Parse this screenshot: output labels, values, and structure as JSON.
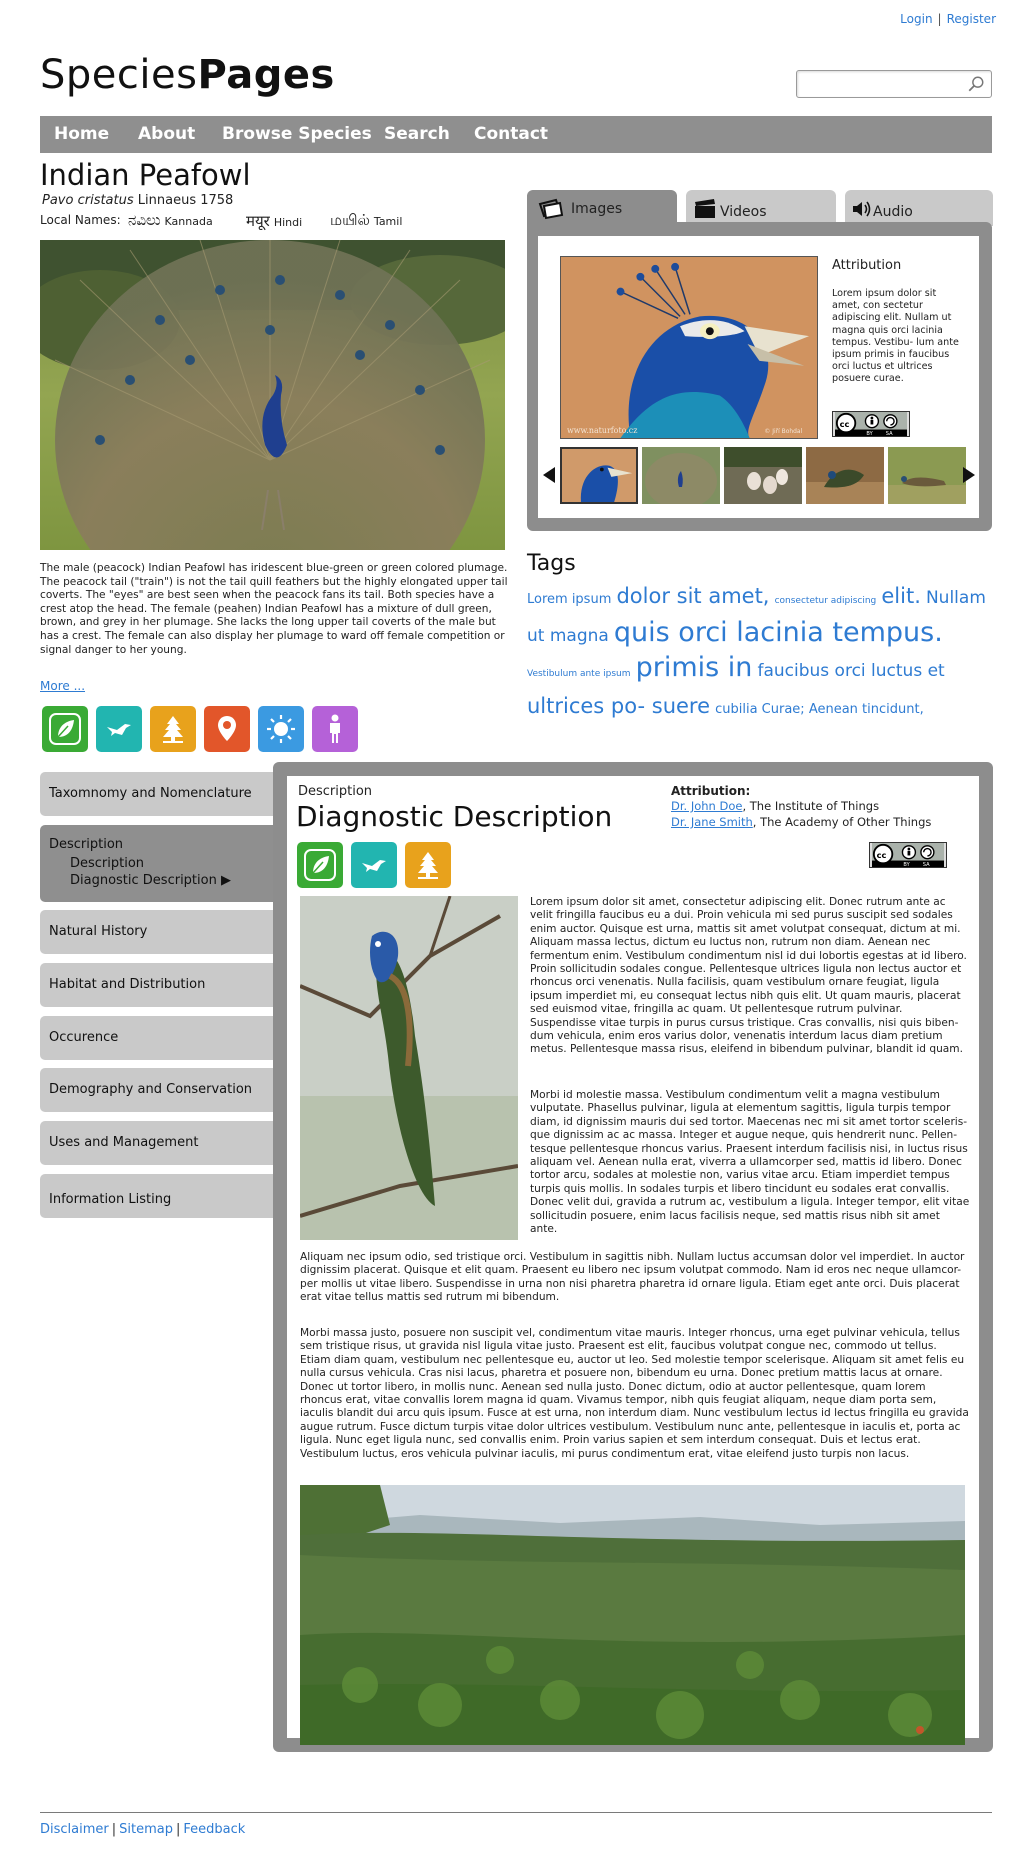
{
  "header": {
    "login": "Login",
    "register": "Register",
    "logo_light": "Species",
    "logo_bold": "Pages",
    "search_placeholder": ""
  },
  "nav": [
    "Home",
    "About",
    "Browse Species",
    "Search",
    "Contact"
  ],
  "species": {
    "common_name": "Indian Peafowl",
    "scientific_name": "Pavo cristatus",
    "authority": "Linnaeus 1758",
    "local_names_label": "Local Names:",
    "local_names": [
      {
        "script": "ನವಿಲು",
        "language": "Kannada"
      },
      {
        "script": "मयूर",
        "language": "Hindi"
      },
      {
        "script": "மயில்",
        "language": "Tamil"
      }
    ],
    "description": "The male (peacock) Indian Peafowl has iridescent blue-green or green colored plumage. The peacock tail (\"train\") is not the tail quill feathers but the highly elongated upper tail coverts. The \"eyes\" are best seen when the peacock fans its tail. Both species have a crest atop the head. The female (peahen) Indian Peafowl has a mixture of dull green, brown, and grey in her plumage. She lacks the long upper tail coverts of the male but has a crest. The female can also display her plumage to ward off female competition or signal danger to her young.",
    "more_link": "More ...",
    "category_icons": [
      "leaf-icon",
      "bird-icon",
      "tree-icon",
      "location-pin-icon",
      "sun-icon",
      "person-icon"
    ]
  },
  "media": {
    "tabs": [
      "Images",
      "Videos",
      "Audio"
    ],
    "attribution_title": "Attribution",
    "attribution_text": "Lorem ipsum dolor sit amet, con sectetur adipiscing elit. Nullam ut magna quis orci lacinia tempus. Vestibu- lum ante ipsum primis in faucibus orci luctus et ultrices posuere curae.",
    "license": "cc by-sa",
    "watermark_left": "www.naturfoto.cz",
    "watermark_right": "© Jiří Bohdal"
  },
  "tags": {
    "title": "Tags",
    "items": [
      {
        "text": "Lorem ipsum",
        "size": 13
      },
      {
        "text": "dolor sit amet,",
        "size": 21
      },
      {
        "text": "consectetur adipiscing",
        "size": 9
      },
      {
        "text": "elit.",
        "size": 21
      },
      {
        "text": "Nullam ut magna",
        "size": 17
      },
      {
        "text": "quis orci lacinia tempus.",
        "size": 27
      },
      {
        "text": "Vestibulum ante ipsum",
        "size": 9
      },
      {
        "text": "primis in",
        "size": 27
      },
      {
        "text": "faucibus orci luctus et",
        "size": 17
      },
      {
        "text": "ultrices po- suere",
        "size": 21
      },
      {
        "text": "cubilia Curae; Aenean tincidunt,",
        "size": 13
      }
    ]
  },
  "left_nav": {
    "items": [
      "Taxomnomy and Nomenclature",
      "Description",
      "Natural History",
      "Habitat and Distribution",
      "Occurence",
      "Demography and Conservation",
      "Uses and Management",
      "Information Listing"
    ],
    "sub_items": [
      "Description",
      "Diagnostic Description ▶"
    ]
  },
  "content": {
    "section_label": "Description",
    "title": "Diagnostic Description",
    "attribution_label": "Attribution:",
    "attributions": [
      {
        "name": "Dr. John Doe",
        "org": ", The Institute of Things"
      },
      {
        "name": "Dr. Jane Smith",
        "org": ", The Academy of Other Things"
      }
    ],
    "icons": [
      "leaf-icon",
      "bird-icon",
      "tree-icon"
    ],
    "p1": "Lorem ipsum dolor sit amet, consectetur adipiscing elit. Donec rutrum ante ac velit fringilla faucibus eu a dui. Proin vehicula mi sed purus suscipit sed sodales enim auctor. Quisque est urna, mattis sit amet volutpat consequat, dictum at mi. Aliquam massa lectus, dictum eu luctus non, rutrum non diam. Aenean nec fermentum enim. Vestibulum condimentum nisl id dui lobortis egestas at id libero. Proin sollicitudin sodales congue. Pellentesque ultrices ligula non lectus auctor et rhoncus orci venenatis. Nulla facilisis, quam vestibulum ornare feugiat, ligula ipsum imperdiet mi, eu consequat lectus nibh quis elit. Ut quam mauris, placerat sed euismod vitae, fringilla ac quam. Ut pellentesque rutrum pulvinar. Suspendisse vitae turpis in purus cursus tristique. Cras convallis, nisi quis biben- dum vehicula, enim eros varius dolor, venenatis interdum lacus diam pretium metus. Pellentesque massa risus, eleifend in bibendum pulvinar, blandit id quam.",
    "p2": "Morbi id molestie massa. Vestibulum condimentum velit a magna vestibulum vulputate. Phasellus pulvinar, ligula at elementum sagittis, ligula turpis tempor diam, id dignissim mauris dui sed tortor. Maecenas nec mi sit amet tortor sceleris- que dignissim ac ac massa. Integer et augue neque, quis hendrerit nunc. Pellen- tesque pellentesque rhoncus varius. Praesent interdum facilisis nisi, in luctus risus aliquam vel. Aenean nulla erat, viverra a ullamcorper sed, mattis id libero. Donec tortor arcu, sodales at molestie non, varius vitae arcu. Etiam imperdiet tempus turpis quis mollis. In sodales turpis et libero tincidunt eu sodales erat convallis. Donec velit dui, gravida a rutrum ac, vestibulum a ligula. Integer tempor, elit vitae sollicitudin posuere, enim lacus facilisis neque, sed mattis risus nibh sit amet ante.",
    "p3": "Aliquam nec ipsum odio, sed tristique orci. Vestibulum in sagittis nibh. Nullam luctus accumsan dolor vel imperdiet. In auctor dignissim placerat. Quisque et elit quam. Praesent eu libero nec ipsum volutpat commodo. Nam id eros nec neque ullamcor- per mollis ut vitae libero. Suspendisse in urna non nisi pharetra pharetra id ornare ligula. Etiam eget ante orci. Duis placerat erat vitae tellus mattis sed rutrum mi bibendum.",
    "p4": "Morbi massa justo, posuere non suscipit vel, condimentum vitae mauris. Integer rhoncus, urna eget pulvinar vehicula, tellus sem tristique risus, ut gravida nisl ligula vitae justo. Praesent est elit, faucibus volutpat congue nec, commodo ut tellus. Etiam diam quam, vestibulum nec pellentesque eu, auctor ut leo. Sed molestie tempor scelerisque. Aliquam sit amet felis eu nulla cursus vehicula. Cras nisi lacus, pharetra et posuere non, bibendum eu urna. Donec pretium mattis lacus at ornare. Donec ut tortor libero, in mollis nunc. Aenean sed nulla justo. Donec dictum, odio at auctor pellentesque, quam lorem rhoncus erat, vitae convallis lorem magna id quam. Vivamus tempor, nibh quis feugiat aliquam, neque diam porta sem, iaculis blandit dui arcu quis ipsum. Fusce at est urna, non interdum diam. Nunc vestibulum lectus id lectus fringilla eu gravida augue rutrum. Fusce dictum turpis vitae dolor ultrices vestibulum. Vestibulum nunc ante, pellentesque in iaculis et, porta ac ligula. Nunc eget ligula nunc, sed convallis enim. Proin varius sapien et sem interdum consequat. Duis et lectus erat. Vestibulum luctus, eros vehicula pulvinar iaculis, mi purus condimentum erat, vitae eleifend justo turpis non lacus."
  },
  "footer": [
    "Disclaimer",
    "Sitemap",
    "Feedback"
  ],
  "colors": {
    "link": "#2e7bd2",
    "nav_gray": "#8f8f8f",
    "tile_green": "#3aaa35",
    "tile_teal": "#22b5b0",
    "tile_yellow": "#e8a21c",
    "tile_orange": "#e2562a",
    "tile_blue": "#3b9ae1",
    "tile_purple": "#b561d8"
  }
}
